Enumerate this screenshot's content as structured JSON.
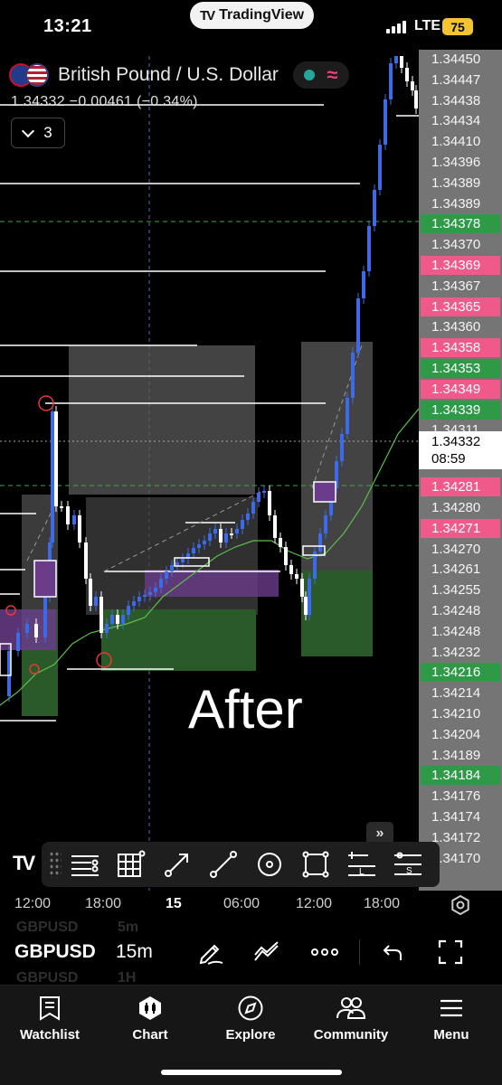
{
  "status_bar": {
    "time": "13:21",
    "app_pill": "TradingView",
    "network": "LTE",
    "battery": "75"
  },
  "symbol": {
    "title": "British Pound / U.S. Dollar",
    "price_line": "1.34332  −0.00461 (−0.34%)",
    "indicator_count": "3"
  },
  "annotation_text": "After",
  "price_scale": {
    "ticks": [
      {
        "value": "1.34450",
        "style": "grey"
      },
      {
        "value": "1.34447",
        "style": "grey"
      },
      {
        "value": "1.34438",
        "style": "grey"
      },
      {
        "value": "1.34434",
        "style": "grey"
      },
      {
        "value": "1.34410",
        "style": "grey"
      },
      {
        "value": "1.34396",
        "style": "grey"
      },
      {
        "value": "1.34389",
        "style": "grey"
      },
      {
        "value": "1.34389",
        "style": "grey"
      },
      {
        "value": "1.34378",
        "style": "green"
      },
      {
        "value": "1.34370",
        "style": "grey"
      },
      {
        "value": "1.34369",
        "style": "red"
      },
      {
        "value": "1.34367",
        "style": "grey"
      },
      {
        "value": "1.34365",
        "style": "red"
      },
      {
        "value": "1.34360",
        "style": "grey"
      },
      {
        "value": "1.34358",
        "style": "red"
      },
      {
        "value": "1.34353",
        "style": "green"
      },
      {
        "value": "1.34349",
        "style": "red"
      },
      {
        "value": "1.34339",
        "style": "green"
      },
      {
        "value": "1.34311",
        "style": "grey"
      },
      {
        "value": "1.34281",
        "style": "red"
      },
      {
        "value": "1.34280",
        "style": "grey"
      },
      {
        "value": "1.34271",
        "style": "red"
      },
      {
        "value": "1.34270",
        "style": "grey"
      },
      {
        "value": "1.34261",
        "style": "grey"
      },
      {
        "value": "1.34255",
        "style": "grey"
      },
      {
        "value": "1.34248",
        "style": "grey"
      },
      {
        "value": "1.34248",
        "style": "grey"
      },
      {
        "value": "1.34232",
        "style": "grey"
      },
      {
        "value": "1.34216",
        "style": "green"
      },
      {
        "value": "1.34214",
        "style": "grey"
      },
      {
        "value": "1.34210",
        "style": "grey"
      },
      {
        "value": "1.34204",
        "style": "grey"
      },
      {
        "value": "1.34189",
        "style": "grey"
      },
      {
        "value": "1.34184",
        "style": "green"
      },
      {
        "value": "1.34176",
        "style": "grey"
      },
      {
        "value": "1.34174",
        "style": "grey"
      },
      {
        "value": "1.34172",
        "style": "grey"
      },
      {
        "value": "1.34170",
        "style": "grey"
      }
    ],
    "current_price": "1.34332",
    "countdown": "08:59"
  },
  "time_axis": {
    "ticks": [
      "12:00",
      "18:00",
      "15",
      "06:00",
      "12:00",
      "18:00"
    ]
  },
  "drawing_tools": [
    {
      "icon": "horizontal-lines-icon"
    },
    {
      "icon": "grid-icon"
    },
    {
      "icon": "arrow-line-icon"
    },
    {
      "icon": "trend-line-icon"
    },
    {
      "icon": "circle-target-icon"
    },
    {
      "icon": "rectangle-icon"
    },
    {
      "icon": "long-position-icon"
    },
    {
      "icon": "short-position-icon"
    }
  ],
  "control_bar": {
    "symbol": "GBPUSD",
    "interval": "15m",
    "ghost_above_symbol": "GBPUSD",
    "ghost_above_interval": "5m",
    "ghost_below_symbol": "GBPUSD",
    "ghost_below_interval": "1H"
  },
  "tabs": [
    {
      "label": "Watchlist",
      "icon": "watchlist-icon"
    },
    {
      "label": "Chart",
      "icon": "chart-icon"
    },
    {
      "label": "Explore",
      "icon": "compass-icon"
    },
    {
      "label": "Community",
      "icon": "community-icon"
    },
    {
      "label": "Menu",
      "icon": "menu-icon"
    }
  ],
  "colors": {
    "background": "#000000",
    "candle_up": "#3d6be8",
    "candle_down": "#ffffff",
    "moving_average": "#5cbf4a",
    "tp_zone": "#2a5a2a",
    "fvg_zone": "#6a3c8a",
    "price_tag_red": "#f05a8a",
    "price_tag_green": "#2e9a48",
    "scale_grey": "#757575"
  }
}
